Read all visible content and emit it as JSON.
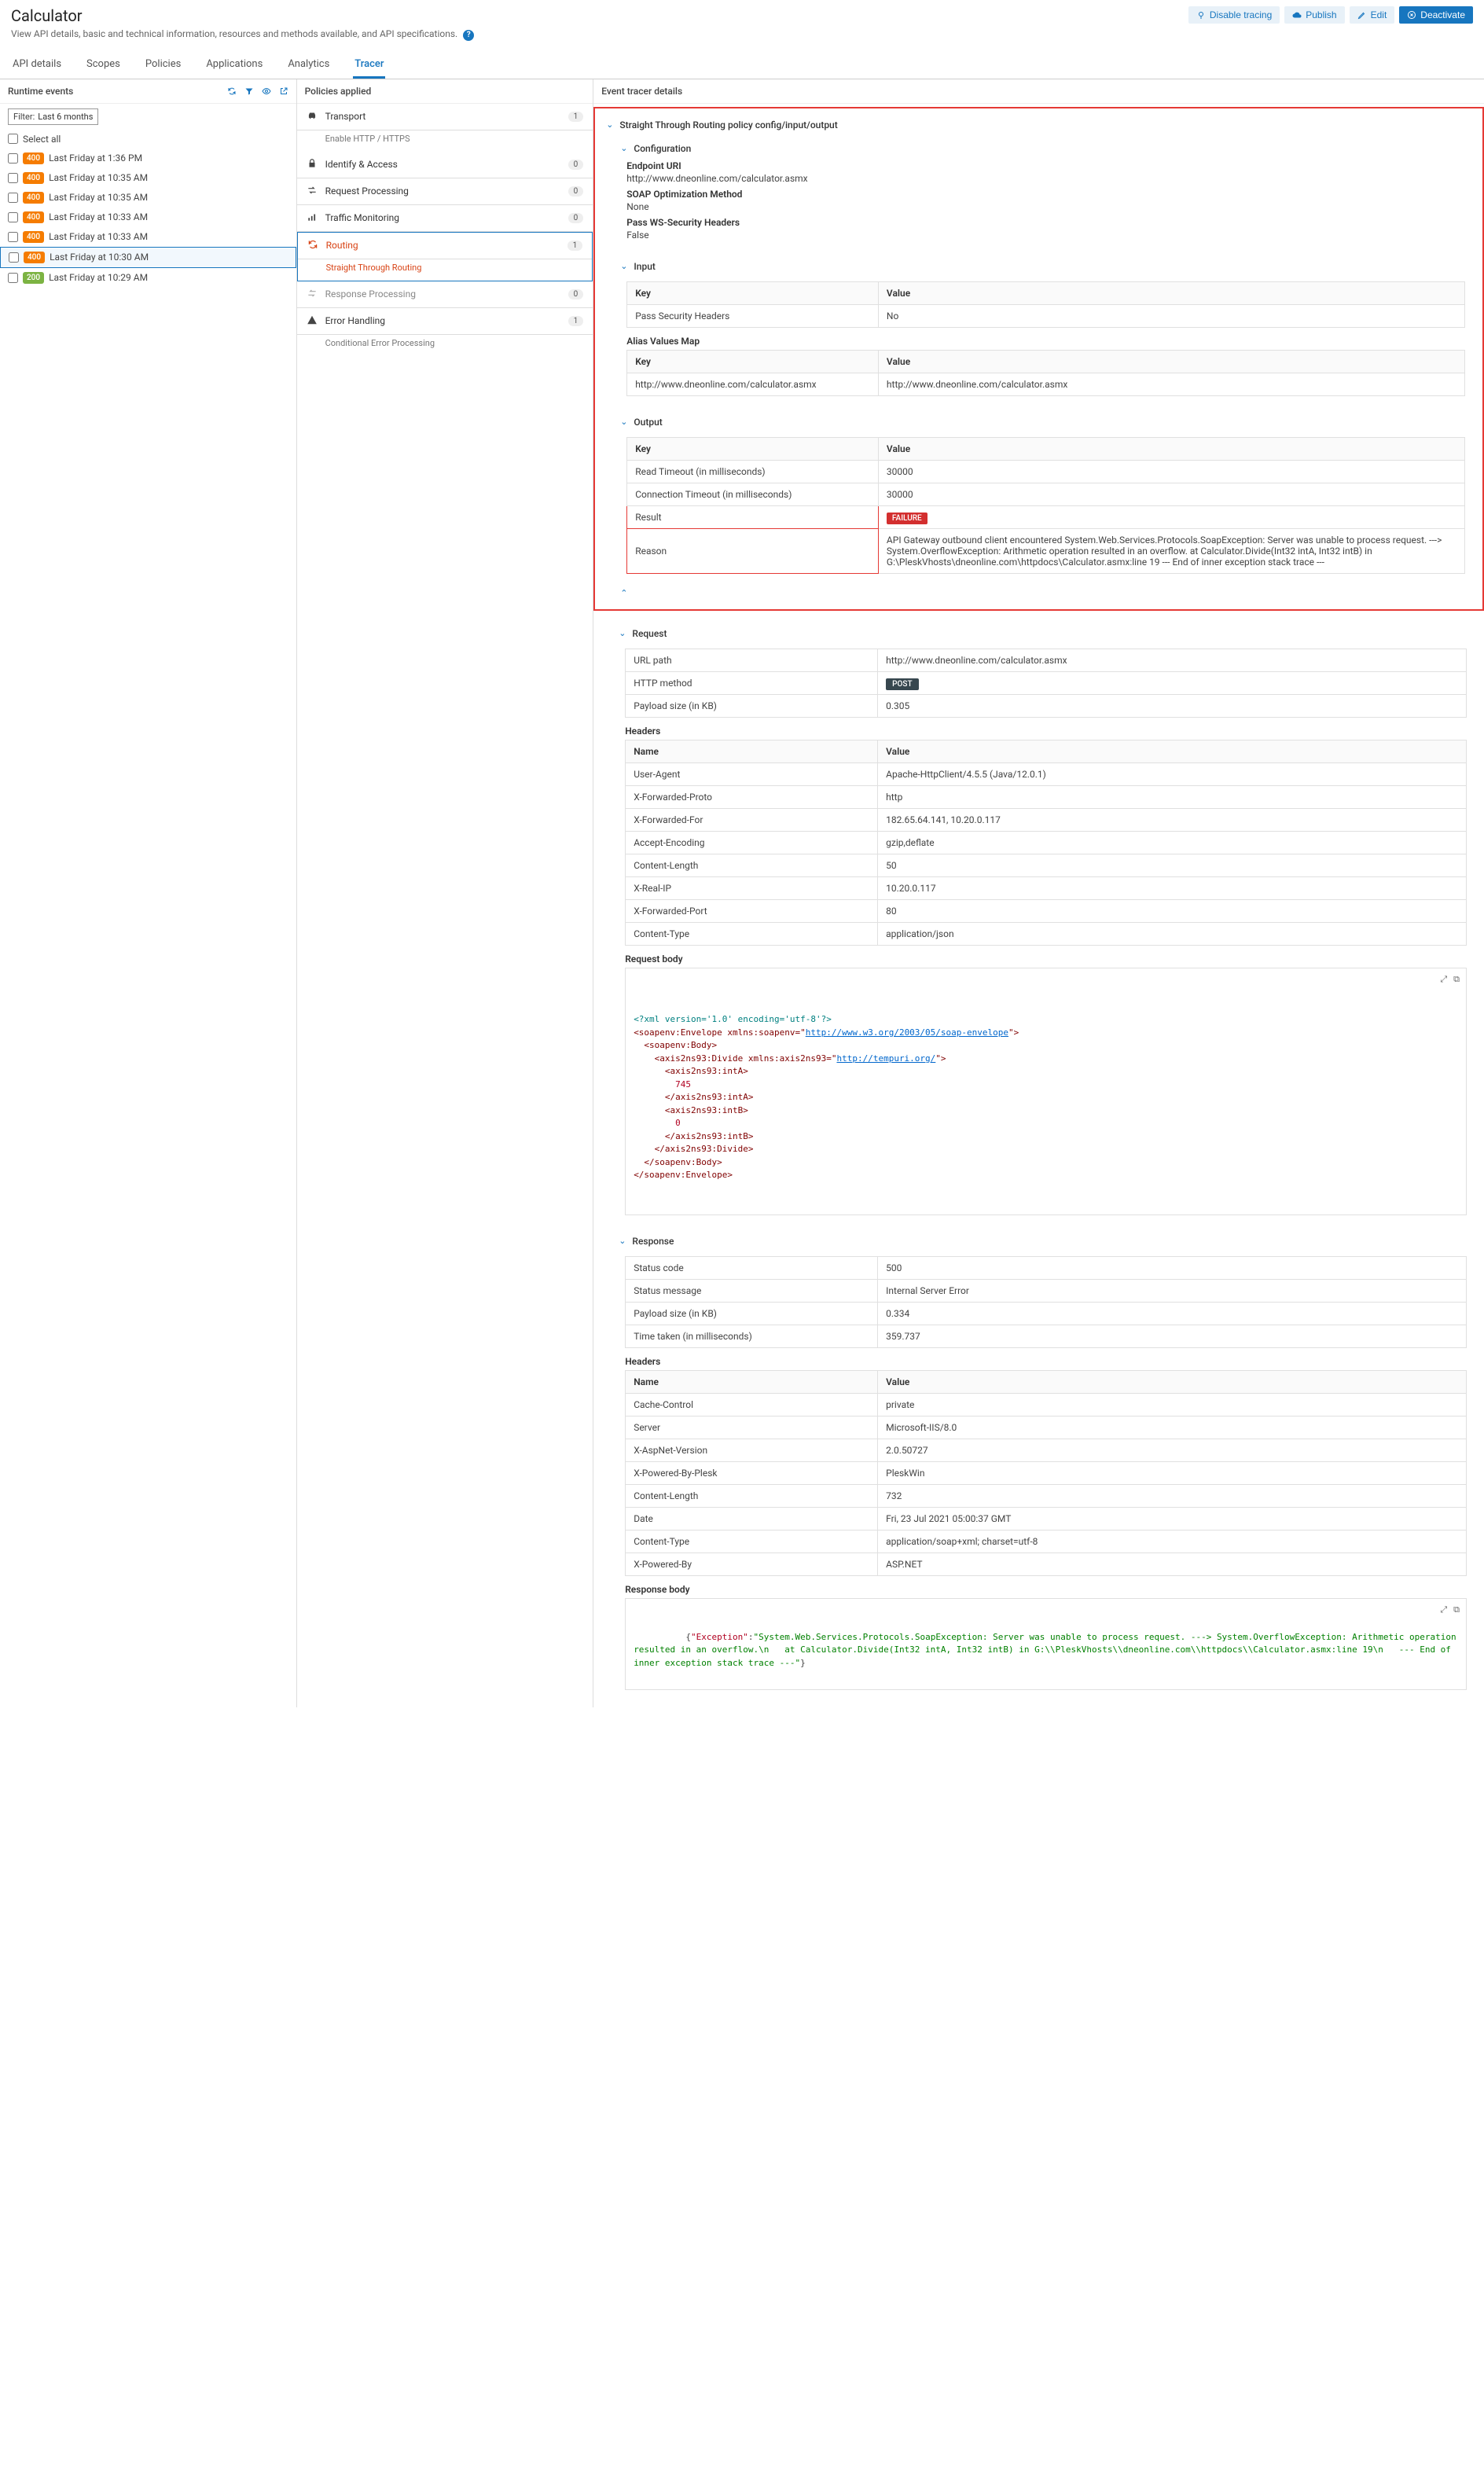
{
  "header": {
    "title": "Calculator",
    "subtitle": "View API details, basic and technical information, resources and methods available, and API specifications.",
    "actions": {
      "disable_tracing": "Disable tracing",
      "publish": "Publish",
      "edit": "Edit",
      "deactivate": "Deactivate"
    }
  },
  "tabs": [
    "API details",
    "Scopes",
    "Policies",
    "Applications",
    "Analytics",
    "Tracer"
  ],
  "active_tab": "Tracer",
  "events_panel": {
    "title": "Runtime events",
    "filter_label": "Filter:",
    "filter_value": "Last 6 months",
    "select_all": "Select all",
    "rows": [
      {
        "code": "400",
        "label": "Last Friday at 1:36 PM"
      },
      {
        "code": "400",
        "label": "Last Friday at 10:35 AM"
      },
      {
        "code": "400",
        "label": "Last Friday at 10:35 AM"
      },
      {
        "code": "400",
        "label": "Last Friday at 10:33 AM"
      },
      {
        "code": "400",
        "label": "Last Friday at 10:33 AM"
      },
      {
        "code": "400",
        "label": "Last Friday at 10:30 AM",
        "selected": true
      },
      {
        "code": "200",
        "label": "Last Friday at 10:29 AM"
      }
    ]
  },
  "policies_panel": {
    "title": "Policies applied",
    "groups": [
      {
        "icon": "car",
        "label": "Transport",
        "count": "1",
        "sub": "Enable HTTP / HTTPS"
      },
      {
        "icon": "lock",
        "label": "Identify & Access",
        "count": "0"
      },
      {
        "icon": "arrows",
        "label": "Request Processing",
        "count": "0"
      },
      {
        "icon": "bars",
        "label": "Traffic Monitoring",
        "count": "0"
      },
      {
        "icon": "refresh",
        "label": "Routing",
        "count": "1",
        "sub": "Straight Through Routing",
        "highlight": true
      },
      {
        "icon": "arrowL",
        "label": "Response Processing",
        "count": "0",
        "muted": true
      },
      {
        "icon": "warn",
        "label": "Error Handling",
        "count": "1",
        "sub": "Conditional Error Processing"
      }
    ]
  },
  "details": {
    "title": "Event tracer details",
    "policy_path": "Straight Through Routing policy config/input/output",
    "configuration": {
      "heading": "Configuration",
      "endpoint_label": "Endpoint URI",
      "endpoint": "http://www.dneonline.com/calculator.asmx",
      "soap_label": "SOAP Optimization Method",
      "soap": "None",
      "ws_label": "Pass WS-Security Headers",
      "ws": "False"
    },
    "input": {
      "heading": "Input",
      "col_key": "Key",
      "col_value": "Value",
      "rows": [
        {
          "k": "Pass Security Headers",
          "v": "No"
        }
      ],
      "alias_heading": "Alias Values Map",
      "alias_rows": [
        {
          "k": "http://www.dneonline.com/calculator.asmx",
          "v": "http://www.dneonline.com/calculator.asmx"
        }
      ]
    },
    "output": {
      "heading": "Output",
      "col_key": "Key",
      "col_value": "Value",
      "rows": [
        {
          "k": "Read Timeout (in milliseconds)",
          "v": "30000"
        },
        {
          "k": "Connection Timeout (in milliseconds)",
          "v": "30000"
        },
        {
          "k": "Result",
          "v_type": "failure",
          "v": "FAILURE"
        },
        {
          "k": "Reason",
          "v": "API Gateway outbound client encountered System.Web.Services.Protocols.SoapException: Server was unable to process request. ---> System.OverflowException: Arithmetic operation resulted in an overflow. at Calculator.Divide(Int32 intA, Int32 intB) in G:\\PleskVhosts\\dneonline.com\\httpdocs\\Calculator.asmx:line 19 --- End of inner exception stack trace ---"
        }
      ]
    },
    "request": {
      "heading": "Request",
      "rows": [
        {
          "k": "URL path",
          "v": "http://www.dneonline.com/calculator.asmx"
        },
        {
          "k": "HTTP method",
          "v_type": "method",
          "v": "POST"
        },
        {
          "k": "Payload size (in KB)",
          "v": "0.305"
        }
      ],
      "headers_heading": "Headers",
      "col_name": "Name",
      "col_value": "Value",
      "headers": [
        {
          "k": "User-Agent",
          "v": "Apache-HttpClient/4.5.5 (Java/12.0.1)"
        },
        {
          "k": "X-Forwarded-Proto",
          "v": "http"
        },
        {
          "k": "X-Forwarded-For",
          "v": "182.65.64.141, 10.20.0.117"
        },
        {
          "k": "Accept-Encoding",
          "v": "gzip,deflate"
        },
        {
          "k": "Content-Length",
          "v": "50"
        },
        {
          "k": "X-Real-IP",
          "v": "10.20.0.117"
        },
        {
          "k": "X-Forwarded-Port",
          "v": "80"
        },
        {
          "k": "Content-Type",
          "v": "application/json"
        }
      ],
      "body_heading": "Request body",
      "body_lines": [
        {
          "t": "<?xml version='1.0' encoding='utf-8'?>",
          "cls": "xml-decl"
        },
        {
          "t": "<soapenv:Envelope xmlns:soapenv=\"http://www.w3.org/2003/05/soap-envelope\">",
          "cls": "xml-tag",
          "link": true
        },
        {
          "t": "  <soapenv:Body>",
          "cls": "xml-tag"
        },
        {
          "t": "    <axis2ns93:Divide xmlns:axis2ns93=\"http://tempuri.org/\">",
          "cls": "xml-tag",
          "link": true
        },
        {
          "t": "      <axis2ns93:intA>",
          "cls": "xml-tag"
        },
        {
          "t": "        745",
          "cls": "xml-text"
        },
        {
          "t": "      </axis2ns93:intA>",
          "cls": "xml-tag"
        },
        {
          "t": "      <axis2ns93:intB>",
          "cls": "xml-tag"
        },
        {
          "t": "        0",
          "cls": "xml-text"
        },
        {
          "t": "      </axis2ns93:intB>",
          "cls": "xml-tag"
        },
        {
          "t": "    </axis2ns93:Divide>",
          "cls": "xml-tag"
        },
        {
          "t": "  </soapenv:Body>",
          "cls": "xml-tag"
        },
        {
          "t": "</soapenv:Envelope>",
          "cls": "xml-tag"
        }
      ]
    },
    "response": {
      "heading": "Response",
      "rows": [
        {
          "k": "Status code",
          "v": "500"
        },
        {
          "k": "Status message",
          "v": "Internal Server Error"
        },
        {
          "k": "Payload size (in KB)",
          "v": "0.334"
        },
        {
          "k": "Time taken (in milliseconds)",
          "v": "359.737"
        }
      ],
      "headers_heading": "Headers",
      "col_name": "Name",
      "col_value": "Value",
      "headers": [
        {
          "k": "Cache-Control",
          "v": "private"
        },
        {
          "k": "Server",
          "v": "Microsoft-IIS/8.0"
        },
        {
          "k": "X-AspNet-Version",
          "v": "2.0.50727"
        },
        {
          "k": "X-Powered-By-Plesk",
          "v": "PleskWin"
        },
        {
          "k": "Content-Length",
          "v": "732"
        },
        {
          "k": "Date",
          "v": "Fri, 23 Jul 2021 05:00:37 GMT"
        },
        {
          "k": "Content-Type",
          "v": "application/soap+xml; charset=utf-8"
        },
        {
          "k": "X-Powered-By",
          "v": "ASP.NET"
        }
      ],
      "body_heading": "Response body",
      "body_json": {
        "key": "\"Exception\"",
        "val": "\"System.Web.Services.Protocols.SoapException: Server was unable to process request. ---> System.OverflowException: Arithmetic operation resulted in an overflow.\\n   at Calculator.Divide(Int32 intA, Int32 intB) in G:\\\\PleskVhosts\\\\dneonline.com\\\\httpdocs\\\\Calculator.asmx:line 19\\n   --- End of inner exception stack trace ---\""
      }
    }
  }
}
